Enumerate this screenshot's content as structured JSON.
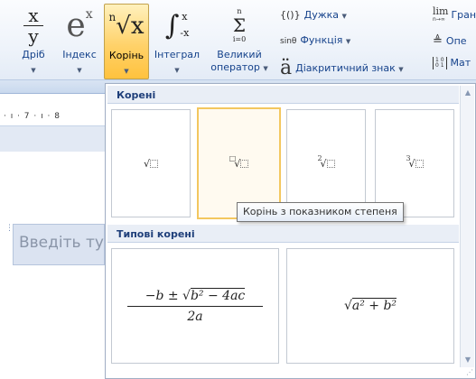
{
  "ribbon": {
    "fraction": {
      "num": "x",
      "den": "y",
      "label": "Дріб"
    },
    "script": {
      "base": "e",
      "sup": "x",
      "label": "Індекс"
    },
    "radical": {
      "index": "n",
      "body": "√x",
      "label": "Корінь"
    },
    "integral": {
      "symbol": "∫",
      "upper": "x",
      "lower": "-x",
      "label": "Інтеграл"
    },
    "large_operator": {
      "symbol": "Σ",
      "upper": "n",
      "lower": "i=0",
      "label_line1": "Великий",
      "label_line2": "оператор"
    },
    "bracket": {
      "symbol": "{()}",
      "label": "Дужка"
    },
    "function": {
      "symbol": "sinθ",
      "label": "Функція"
    },
    "accent": {
      "symbol": "ä",
      "label": "Діакритичний знак"
    },
    "limit": {
      "symbol": "lim",
      "sub": "n→∞",
      "label": "Гран"
    },
    "operator": {
      "symbol": "≜",
      "label": "Опе"
    },
    "matrix": {
      "symbol": "[10;01]",
      "label": "Мат"
    }
  },
  "ruler_text": "· ı · 7 · ı · 8",
  "document": {
    "placeholder": "Введіть ту"
  },
  "gallery": {
    "section1_title": "Корені",
    "section2_title": "Типові корені",
    "radicals": [
      {
        "name": "square-root",
        "index": ""
      },
      {
        "name": "root-with-degree",
        "index": "□"
      },
      {
        "name": "square-root-degree-2",
        "index": "2"
      },
      {
        "name": "cube-root",
        "index": "3"
      }
    ],
    "tooltip": "Корінь з показником степеня",
    "typical": [
      {
        "name": "quadratic-formula",
        "numerator_parts": [
          "−b ± ",
          "b² − 4ac"
        ],
        "denominator": "2a"
      },
      {
        "name": "pythagorean-root",
        "expr": "a² + b²"
      }
    ]
  }
}
